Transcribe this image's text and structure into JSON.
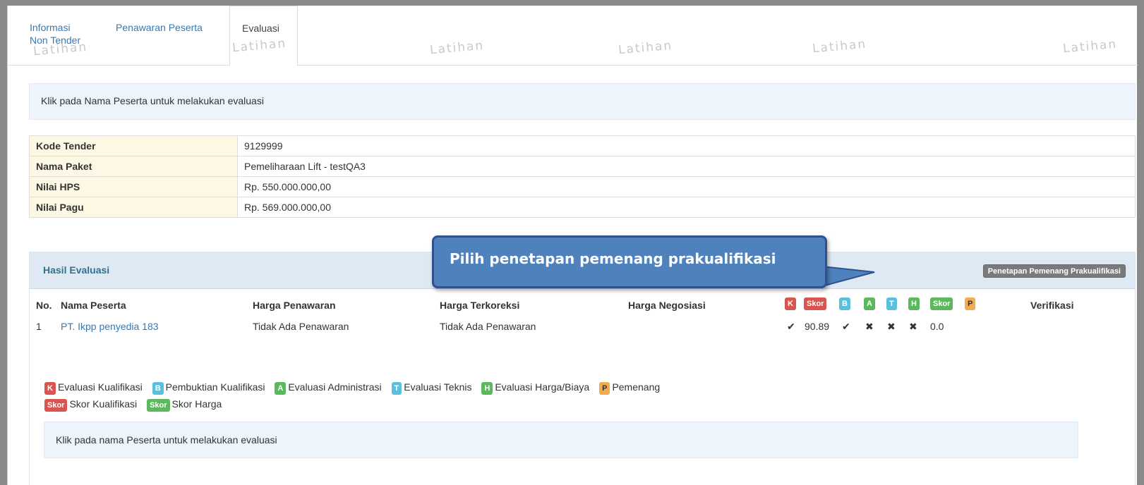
{
  "tabs": {
    "informasi_line1": "Informasi",
    "informasi_line2": "Non Tender",
    "penawaran": "Penawaran Peserta",
    "evaluasi": "Evaluasi"
  },
  "watermark": "Latihan",
  "top_alert": "Klik pada Nama Peserta untuk melakukan evaluasi",
  "info_table": [
    {
      "label": "Kode Tender",
      "value": "9129999"
    },
    {
      "label": "Nama Paket",
      "value": "Pemeliharaan Lift - testQA3"
    },
    {
      "label": "Nilai HPS",
      "value": "Rp. 550.000.000,00"
    },
    {
      "label": "Nilai Pagu",
      "value": "Rp. 569.000.000,00"
    }
  ],
  "hasil": {
    "title": "Hasil Evaluasi",
    "button": "Penetapan Pemenang Prakualifikasi",
    "headers": {
      "no": "No.",
      "nama": "Nama Peserta",
      "harga_penawaran": "Harga Penawaran",
      "harga_terkoreksi": "Harga Terkoreksi",
      "harga_negosiasi": "Harga Negosiasi",
      "verifikasi": "Verifikasi"
    },
    "header_badges": {
      "k": "K",
      "skor_k": "Skor",
      "b": "B",
      "a": "A",
      "t": "T",
      "h": "H",
      "skor_h": "Skor",
      "p": "P"
    },
    "rows": [
      {
        "no": "1",
        "nama": "PT. Ikpp penyedia 183",
        "harga_penawaran": "Tidak Ada Penawaran",
        "harga_terkoreksi": "Tidak Ada Penawaran",
        "k": "✔",
        "skor_k": "90.89",
        "b": "✔",
        "a": "✖",
        "t": "✖",
        "h": "✖",
        "skor_h": "0.0"
      }
    ],
    "legend": {
      "k_badge": "K",
      "k_text": "Evaluasi Kualifikasi",
      "b_badge": "B",
      "b_text": "Pembuktian Kualifikasi",
      "a_badge": "A",
      "a_text": "Evaluasi Administrasi",
      "t_badge": "T",
      "t_text": "Evaluasi Teknis",
      "h_badge": "H",
      "h_text": "Evaluasi Harga/Biaya",
      "p_badge": "P",
      "p_text": "Pemenang",
      "skork_badge": "Skor",
      "skork_text": "Skor Kualifikasi",
      "skorh_badge": "Skor",
      "skorh_text": "Skor Harga"
    },
    "bottom_alert": "Klik pada nama Peserta untuk melakukan evaluasi"
  },
  "callout": "Pilih penetapan pemenang prakualifikasi",
  "colors": {
    "link": "#337ab7",
    "badge_red": "#d9534f",
    "badge_blue": "#5bc0de",
    "badge_green": "#5cb85c",
    "badge_yellow": "#f0ad4e",
    "callout": "#4f81bd"
  }
}
